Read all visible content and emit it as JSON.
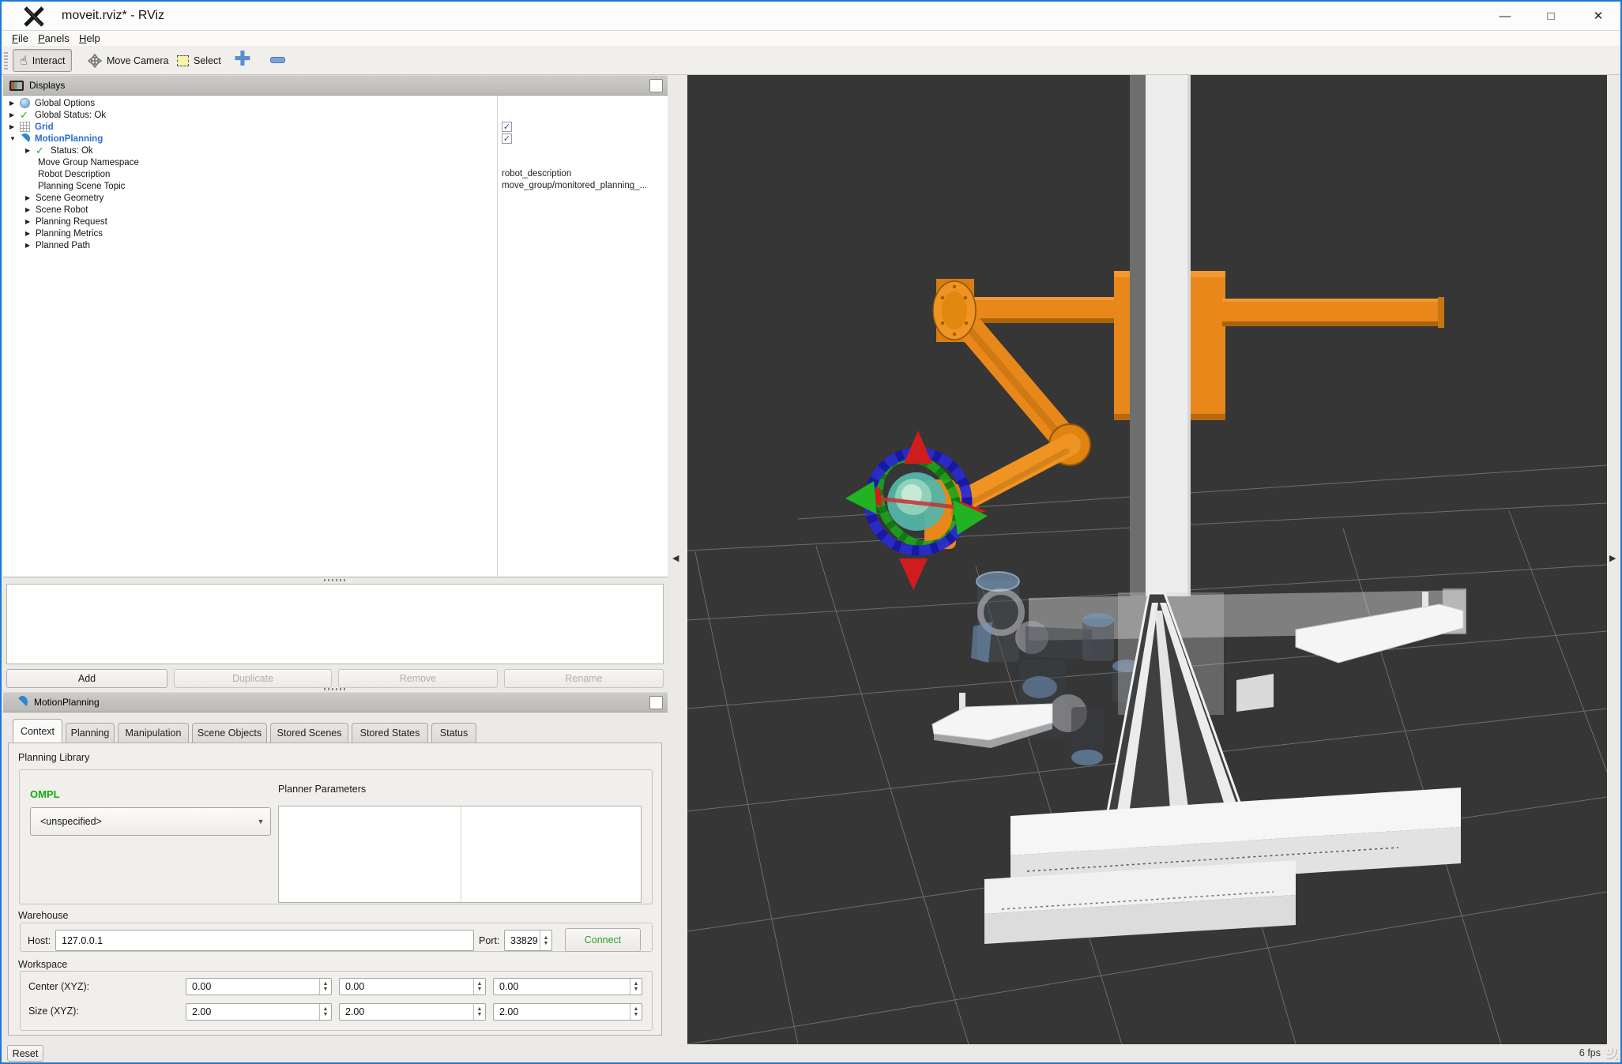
{
  "window": {
    "title": "moveit.rviz* - RViz",
    "minimize_icon": "—",
    "maximize_icon": "□",
    "close_icon": "✕"
  },
  "menu": {
    "items": [
      {
        "label": "File"
      },
      {
        "label": "Panels"
      },
      {
        "label": "Help"
      }
    ]
  },
  "toolbar": {
    "interact_label": "Interact",
    "move_camera_label": "Move Camera",
    "select_label": "Select",
    "icons": {
      "interact": "hand-pointer",
      "move_camera": "four-way-arrows",
      "select": "selection-box",
      "add_tool": "plus",
      "remove_tool": "minus"
    }
  },
  "displays_panel": {
    "title": "Displays",
    "tree": [
      {
        "label": "Global Options",
        "icon": "globe",
        "arrow": "collapsed"
      },
      {
        "label": "Global Status: Ok",
        "icon": "check",
        "arrow": "collapsed"
      },
      {
        "label": "Grid",
        "icon": "grid",
        "arrow": "collapsed",
        "checked": true
      },
      {
        "label": "MotionPlanning",
        "icon": "moveit-swoosh",
        "arrow": "expanded",
        "checked": true
      },
      {
        "label": "Status: Ok",
        "icon": "check",
        "arrow": "collapsed",
        "indent": 1
      },
      {
        "label": "Move Group Namespace",
        "indent": 1
      },
      {
        "label": "Robot Description",
        "indent": 1,
        "value": "robot_description"
      },
      {
        "label": "Planning Scene Topic",
        "indent": 1,
        "value": "move_group/monitored_planning_..."
      },
      {
        "label": "Scene Geometry",
        "arrow": "collapsed",
        "indent": 1
      },
      {
        "label": "Scene Robot",
        "arrow": "collapsed",
        "indent": 1
      },
      {
        "label": "Planning Request",
        "arrow": "collapsed",
        "indent": 1
      },
      {
        "label": "Planning Metrics",
        "arrow": "collapsed",
        "indent": 1
      },
      {
        "label": "Planned Path",
        "arrow": "collapsed",
        "indent": 1
      }
    ],
    "buttons": [
      {
        "label": "Add",
        "enabled": true
      },
      {
        "label": "Duplicate",
        "enabled": false
      },
      {
        "label": "Remove",
        "enabled": false
      },
      {
        "label": "Rename",
        "enabled": false
      }
    ]
  },
  "motion_planning": {
    "title": "MotionPlanning",
    "tabs": [
      {
        "label": "Context",
        "active": true
      },
      {
        "label": "Planning",
        "active": false
      },
      {
        "label": "Manipulation",
        "active": false
      },
      {
        "label": "Scene Objects",
        "active": false
      },
      {
        "label": "Stored Scenes",
        "active": false
      },
      {
        "label": "Stored States",
        "active": false
      },
      {
        "label": "Status",
        "active": false
      }
    ],
    "context": {
      "planning_library_label": "Planning Library",
      "library_name": "OMPL",
      "planner_value": "<unspecified>",
      "planner_parameters_label": "Planner Parameters",
      "warehouse_label": "Warehouse",
      "host_label": "Host:",
      "host_value": "127.0.0.1",
      "port_label": "Port:",
      "port_value": "33829",
      "connect_label": "Connect",
      "workspace_label": "Workspace",
      "center_label": "Center (XYZ):",
      "center_values": [
        "0.00",
        "0.00",
        "0.00"
      ],
      "size_label": "Size (XYZ):",
      "size_values": [
        "2.00",
        "2.00",
        "2.00"
      ]
    }
  },
  "status_bar": {
    "reset_label": "Reset",
    "fps": "6 fps"
  },
  "viewport": {
    "collapse_left_icon": "◀",
    "collapse_right_icon": "▶"
  },
  "colors": {
    "window_border": "#1e78d7",
    "panel_bg": "#eceae6",
    "robot_orange": "#e8871a",
    "tree_highlight_blue": "#2a6fc9",
    "check_green": "#2e9e2e",
    "ompl_green": "#0faf0f",
    "connect_green": "#2ca02c",
    "viewport_bg": "#363636"
  }
}
